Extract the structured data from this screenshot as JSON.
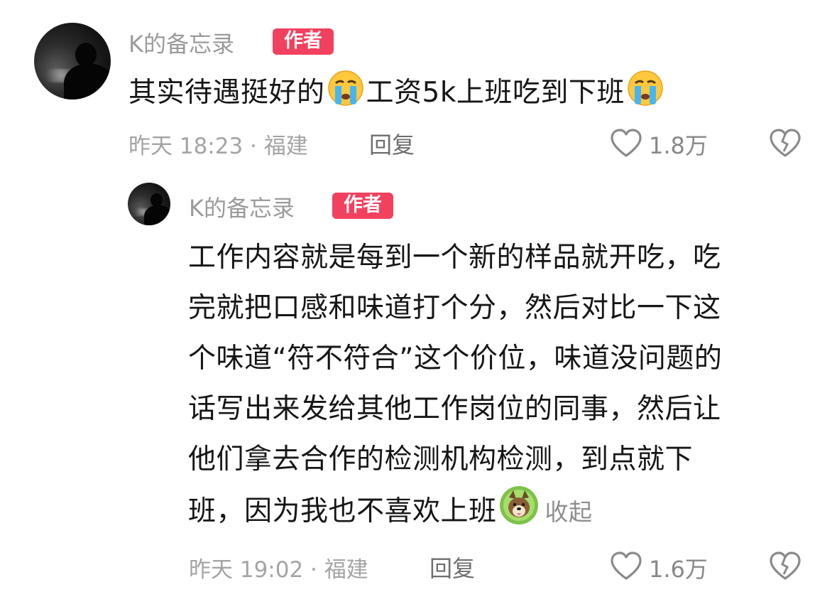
{
  "comment": {
    "author": "K的备忘录",
    "badge": "作者",
    "text_part1": "其实待遇挺好的",
    "text_part2": "工资5k上班吃到下班",
    "meta": "昨天 18:23 · 福建",
    "reply_label": "回复",
    "likes": "1.8万",
    "emoji": "crying-face"
  },
  "reply": {
    "author": "K的备忘录",
    "badge": "作者",
    "lines": [
      "工作内容就是每到一个新的样品就开吃，吃",
      "完就把口感和味道打个分，然后对比一下这",
      "个味道“符不符合”这个价位，味道没问题的",
      "话写出来发给其他工作岗位的同事，然后让",
      "他们拿去合作的检测机构检测，到点就下"
    ],
    "last_line": "班，因为我也不喜欢上班",
    "collapse_label": "收起",
    "meta": "昨天 19:02 · 福建",
    "reply_label": "回复",
    "likes": "1.6万",
    "emoji": "dog-sticker"
  },
  "colors": {
    "badge": "#f2415e",
    "text": "#161616",
    "meta": "#a4a4a4"
  }
}
